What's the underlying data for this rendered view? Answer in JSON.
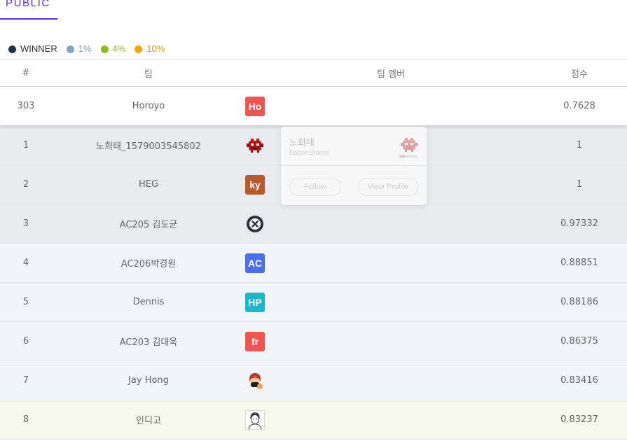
{
  "tabs": [
    {
      "label": "PUBLIC",
      "active": true
    }
  ],
  "legend": [
    {
      "label": "WINNER",
      "color": "#223348",
      "text_color": "#333333"
    },
    {
      "label": "1%",
      "color": "#7ea6c9",
      "text_color": "#7ea6c9"
    },
    {
      "label": "4%",
      "color": "#8dbd1c",
      "text_color": "#8dbd1c"
    },
    {
      "label": "10%",
      "color": "#f0a500",
      "text_color": "#e29c00"
    }
  ],
  "table": {
    "headers": {
      "rank": "#",
      "team": "팀",
      "members": "팀 멤버",
      "score": "점수"
    },
    "my_row": {
      "rank": "303",
      "team": "Horoyo",
      "score": "0.7628",
      "avatar": {
        "type": "text",
        "text": "Ho",
        "color": "#f0554f"
      }
    },
    "rows": [
      {
        "rank": "1",
        "team": "노희태_1579003545802",
        "score": "1",
        "tier": "winner",
        "avatar": {
          "type": "icon",
          "icon": "red-monster-icon"
        }
      },
      {
        "rank": "2",
        "team": "HEG",
        "score": "1",
        "tier": "winner",
        "avatar": {
          "type": "text",
          "text": "ky",
          "color": "#b85a2a"
        }
      },
      {
        "rank": "3",
        "team": "AC205 김도균",
        "score": "0.97332",
        "tier": "winner",
        "avatar": {
          "type": "icon",
          "icon": "x-circle-icon"
        }
      },
      {
        "rank": "4",
        "team": "AC206박경원",
        "score": "0.88851",
        "tier": "pct1",
        "avatar": {
          "type": "text",
          "text": "AC",
          "color": "#4a70f0"
        }
      },
      {
        "rank": "5",
        "team": "Dennis",
        "score": "0.88186",
        "tier": "pct1",
        "avatar": {
          "type": "text",
          "text": "HP",
          "color": "#1ab8c9"
        }
      },
      {
        "rank": "6",
        "team": "AC203 김대욱",
        "score": "0.86375",
        "tier": "pct1",
        "avatar": {
          "type": "text",
          "text": "fr",
          "color": "#f0554f"
        }
      },
      {
        "rank": "7",
        "team": "Jay Hong",
        "score": "0.83416",
        "tier": "pct1",
        "avatar": {
          "type": "icon",
          "icon": "masked-person-icon"
        }
      },
      {
        "rank": "8",
        "team": "인디고",
        "score": "0.83237",
        "tier": "pct4",
        "avatar": {
          "type": "icon",
          "icon": "sketch-person-icon"
        }
      }
    ]
  },
  "popup": {
    "name": "노희태",
    "rank_label": "Dacon Bronze",
    "progress": 0.3,
    "follow_label": "Follow",
    "profile_label": "View Profile",
    "avatar_icon": "red-monster-icon"
  }
}
